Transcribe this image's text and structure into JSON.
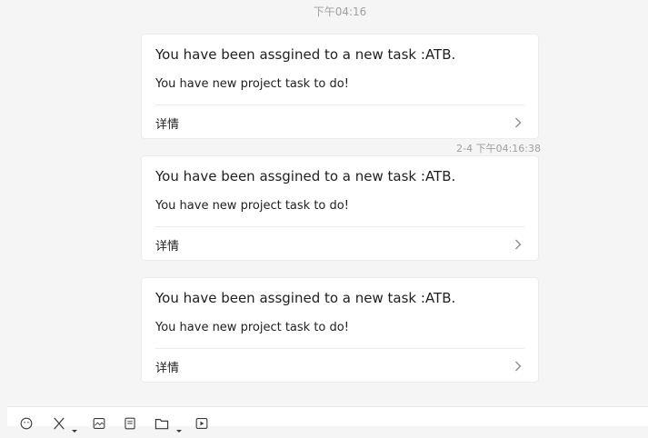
{
  "chat": {
    "top_timestamp": "下午04:16",
    "messages": [
      {
        "title": "You have been assgined to a new task :ATB.",
        "body": "You have new project task to do!",
        "detail_label": "详情"
      },
      {
        "title": "You have been assgined to a new task :ATB.",
        "body": "You have new project task to do!",
        "detail_label": "详情",
        "sent_time": "2-4 下午04:16:38"
      },
      {
        "title": "You have been assgined to a new task :ATB.",
        "body": "You have new project task to do!",
        "detail_label": "详情"
      }
    ]
  },
  "toolbar": {
    "icons": [
      "emoji-icon",
      "scissors-icon",
      "image-icon",
      "document-icon",
      "folder-icon",
      "video-icon"
    ]
  },
  "colors": {
    "background": "#f5f5f5",
    "card": "#ffffff",
    "muted_text": "#a0a0a0",
    "text": "#1f1f1f"
  }
}
